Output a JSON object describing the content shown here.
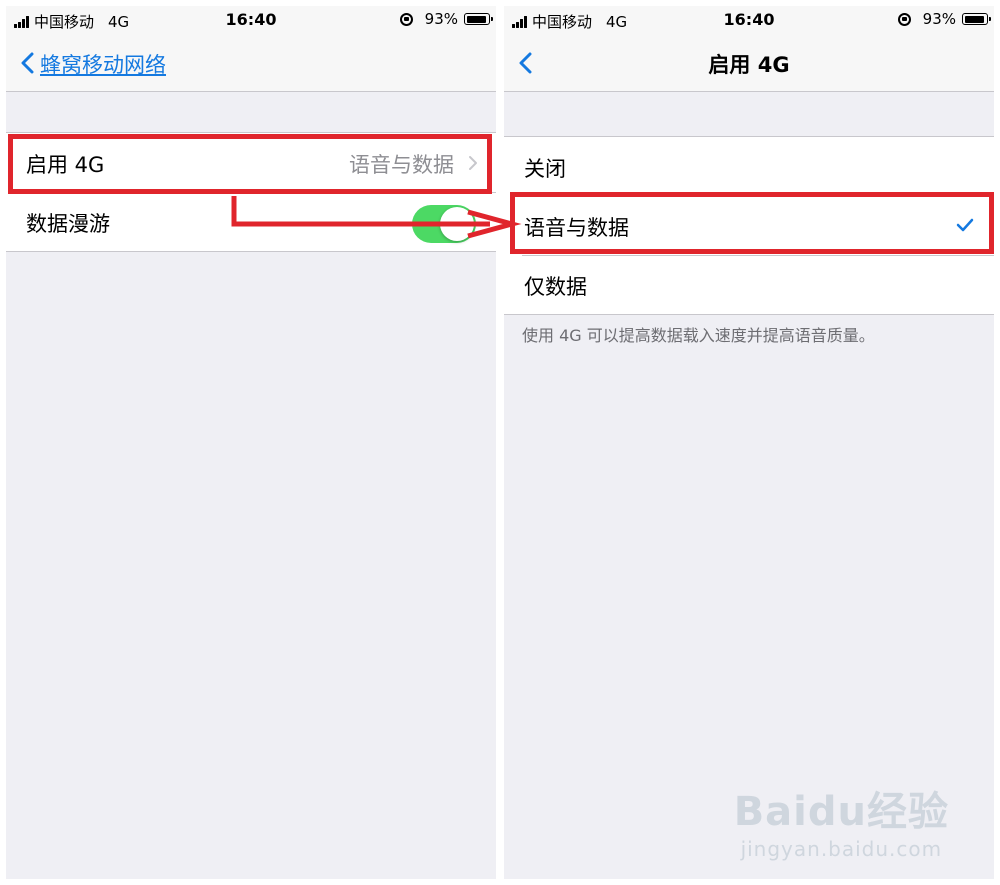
{
  "left": {
    "status": {
      "carrier": "中国移动",
      "network": "4G",
      "time": "16:40",
      "battery": "93%"
    },
    "nav": {
      "back_label": "蜂窝移动网络"
    },
    "rows": [
      {
        "label": "启用 4G",
        "detail": "语音与数据"
      },
      {
        "label": "数据漫游",
        "toggle": true
      }
    ]
  },
  "right": {
    "status": {
      "carrier": "中国移动",
      "network": "4G",
      "time": "16:40",
      "battery": "93%"
    },
    "nav": {
      "title": "启用 4G"
    },
    "options": [
      {
        "label": "关闭",
        "selected": false
      },
      {
        "label": "语音与数据",
        "selected": true
      },
      {
        "label": "仅数据",
        "selected": false
      }
    ],
    "footer": "使用 4G 可以提高数据载入速度并提高语音质量。"
  },
  "watermark": {
    "brand": "Baidu经验",
    "url": "jingyan.baidu.com"
  },
  "colors": {
    "accent": "#1479e0",
    "toggle_on": "#4cd964",
    "annotation": "#e0252c"
  },
  "battery_level": 0.93
}
